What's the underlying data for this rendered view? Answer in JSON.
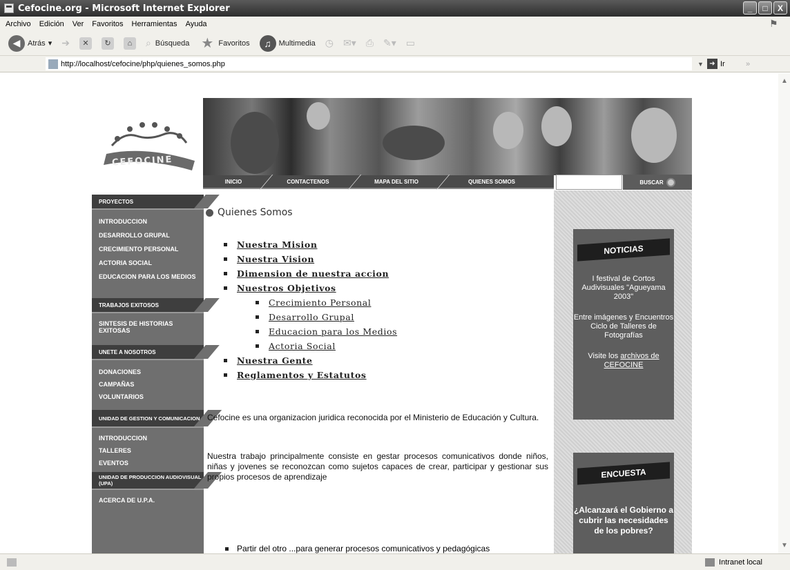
{
  "window": {
    "title": "Cefocine.org - Microsoft Internet Explorer",
    "controls": [
      "_",
      "□",
      "X"
    ]
  },
  "menubar": [
    "Archivo",
    "Edición",
    "Ver",
    "Favoritos",
    "Herramientas",
    "Ayuda"
  ],
  "toolbar": {
    "back": "Atrás",
    "search": "Búsqueda",
    "favorites": "Favoritos",
    "media": "Multimedia"
  },
  "address": {
    "label": "",
    "url": "http://localhost/cefocine/php/quienes_somos.php",
    "go": "Ir"
  },
  "status": {
    "zone": "Intranet local"
  },
  "site": {
    "logo_text": "CEFOCINE",
    "nav": [
      "INICIO",
      "CONTACTENOS",
      "MAPA DEL SITIO",
      "QUIENES SOMOS"
    ],
    "search_button": "BUSCAR",
    "sidebar": [
      {
        "type": "head",
        "label": "PROYECTOS"
      },
      {
        "type": "items",
        "labels": [
          "INTRODUCCION",
          "DESARROLLO GRUPAL",
          "CRECIMIENTO PERSONAL",
          "ACTORIA SOCIAL",
          "EDUCACION PARA LOS MEDIOS"
        ]
      },
      {
        "type": "head",
        "label": "TRABAJOS EXITOSOS"
      },
      {
        "type": "items",
        "labels": [
          "SINTESIS DE HISTORIAS EXITOSAS"
        ]
      },
      {
        "type": "head",
        "label": "UNETE A NOSOTROS"
      },
      {
        "type": "items",
        "labels": [
          "DONACIONES",
          "CAMPAÑAS",
          "VOLUNTARIOS"
        ]
      },
      {
        "type": "head",
        "label": "UNIDAD DE GESTION Y COMUNICACION"
      },
      {
        "type": "items",
        "labels": [
          "INTRODUCCION",
          "TALLERES",
          "EVENTOS"
        ]
      },
      {
        "type": "head",
        "label": "UNIDAD DE PRODUCCION AUDIOVISUAL (UPA)"
      },
      {
        "type": "items",
        "labels": [
          "ACERCA DE U.P.A."
        ]
      }
    ],
    "section_title": "Quienes Somos",
    "links": [
      "Nuestra Mision",
      "Nuestra Vision",
      "Dimension de nuestra accion",
      "Nuestros Objetivos"
    ],
    "sub_links": [
      "Crecimiento Personal",
      "Desarrollo Grupal",
      "Educacion para los Medios",
      "Actoria Social"
    ],
    "links_after": [
      "Nuestra Gente",
      "Reglamentos y Estatutos"
    ],
    "para1": "Cefocine es una organizacion juridica reconocida por el Ministerio de Educación y Cultura.",
    "para2": "Nuestra trabajo principalmente consiste en gestar procesos comunicativos donde niños, niñas y jovenes se reconozcan como sujetos capaces de crear, participar y gestionar sus propios procesos de aprendizaje",
    "bottom_bullet": "Partir del otro ...para generar procesos comunicativos y pedagógicas",
    "noticias": {
      "title": "NOTICIAS",
      "item1": "I festival de Cortos Audivisuales \"Agueyama 2003\"",
      "item2": "Entre imágenes y Encuentros Ciclo de Talleres de Fotografías",
      "visit_prefix": "Visite los",
      "visit_link": "archivos de CEFOCINE"
    },
    "encuesta": {
      "title": "ENCUESTA",
      "question": "¿Alcanzará el Gobierno a cubrir las necesidades de los pobres?"
    }
  }
}
